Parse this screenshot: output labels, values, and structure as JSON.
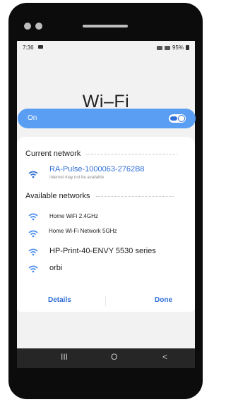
{
  "status": {
    "time": "7:36",
    "battery": "95%"
  },
  "title": "Wi–Fi",
  "toggle": {
    "label": "On",
    "state": true
  },
  "current_section_label": "Current network",
  "current_network": {
    "name": "RA-Pulse-1000063-2762B8",
    "status": "Internet may not be available"
  },
  "available_section_label": "Available networks",
  "networks": [
    {
      "name": "Home WiFi 2.4GHz"
    },
    {
      "name": "Home Wi-Fi Network 5GHz"
    },
    {
      "name": "HP-Print-40-ENVY 5530 series"
    },
    {
      "name": "orbi"
    }
  ],
  "actions": {
    "details": "Details",
    "done": "Done"
  },
  "nav": {
    "recents": "III",
    "home": "O",
    "back": "<"
  },
  "colors": {
    "accent": "#2f6fd6",
    "toggle_bar": "#5a9ef3"
  },
  "icons": [
    "wifi-icon",
    "notification-icon",
    "battery-icon",
    "signal-icon"
  ]
}
